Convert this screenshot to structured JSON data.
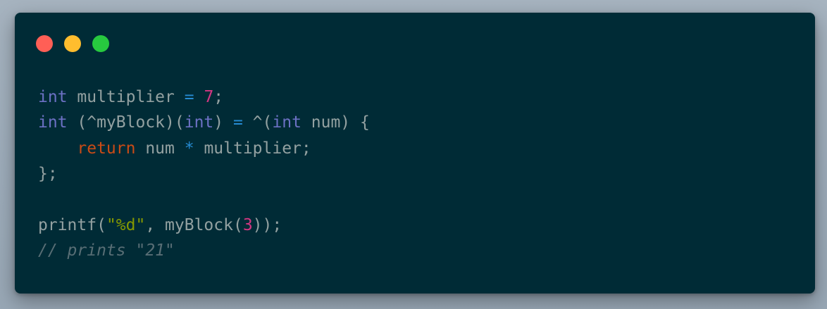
{
  "window": {
    "controls": [
      {
        "name": "close",
        "color": "#ff5f56"
      },
      {
        "name": "minimize",
        "color": "#ffbd2e"
      },
      {
        "name": "zoom",
        "color": "#27c93f"
      }
    ]
  },
  "code": {
    "lines": [
      [
        {
          "t": "int",
          "c": "kw"
        },
        {
          "t": " multiplier ",
          "c": ""
        },
        {
          "t": "=",
          "c": "op"
        },
        {
          "t": " ",
          "c": ""
        },
        {
          "t": "7",
          "c": "num"
        },
        {
          "t": ";",
          "c": ""
        }
      ],
      [
        {
          "t": "int",
          "c": "kw"
        },
        {
          "t": " (^myBlock)(",
          "c": ""
        },
        {
          "t": "int",
          "c": "kw"
        },
        {
          "t": ") ",
          "c": ""
        },
        {
          "t": "=",
          "c": "op"
        },
        {
          "t": " ^(",
          "c": ""
        },
        {
          "t": "int",
          "c": "kw"
        },
        {
          "t": " num) {",
          "c": ""
        }
      ],
      [
        {
          "t": "    ",
          "c": ""
        },
        {
          "t": "return",
          "c": "ret"
        },
        {
          "t": " num ",
          "c": ""
        },
        {
          "t": "*",
          "c": "op"
        },
        {
          "t": " multiplier;",
          "c": ""
        }
      ],
      [
        {
          "t": "};",
          "c": ""
        }
      ],
      [],
      [
        {
          "t": "printf(",
          "c": ""
        },
        {
          "t": "\"%d\"",
          "c": "str"
        },
        {
          "t": ", myBlock(",
          "c": ""
        },
        {
          "t": "3",
          "c": "num"
        },
        {
          "t": "));",
          "c": ""
        }
      ],
      [
        {
          "t": "// prints \"21\"",
          "c": "cm"
        }
      ]
    ]
  }
}
